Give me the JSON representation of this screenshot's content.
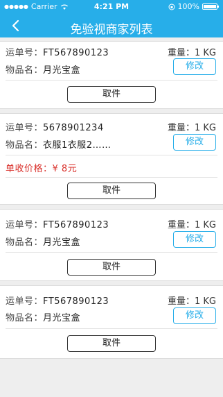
{
  "status_bar": {
    "carrier": "Carrier",
    "time": "4:21 PM",
    "battery": "100%"
  },
  "nav": {
    "title": "免验视商家列表"
  },
  "cards": [
    {
      "waybill_label": "运单号：",
      "waybill": "FT567890123",
      "weight": "重量：1 KG",
      "item_label": "物品名：",
      "item": "月光宝盒",
      "edit": "修改",
      "pickup": "取件"
    },
    {
      "waybill_label": "运单号：",
      "waybill": "5678901234",
      "weight": "重量：1 KG",
      "item_label": "物品名：",
      "item": "衣服1衣服2……",
      "edit": "修改",
      "price_label": "单收价格：",
      "price": "¥ 8元",
      "pickup": "取件"
    },
    {
      "waybill_label": "运单号：",
      "waybill": "FT567890123",
      "weight": "重量：1 KG",
      "item_label": "物品名：",
      "item": "月光宝盒",
      "edit": "修改",
      "pickup": "取件"
    },
    {
      "waybill_label": "运单号：",
      "waybill": "FT567890123",
      "weight": "重量：1 KG",
      "item_label": "物品名：",
      "item": "月光宝盒",
      "edit": "修改",
      "pickup": "取件"
    }
  ],
  "colors": {
    "accent": "#27aee9",
    "price": "#d9302b",
    "background": "#eeeeee"
  }
}
